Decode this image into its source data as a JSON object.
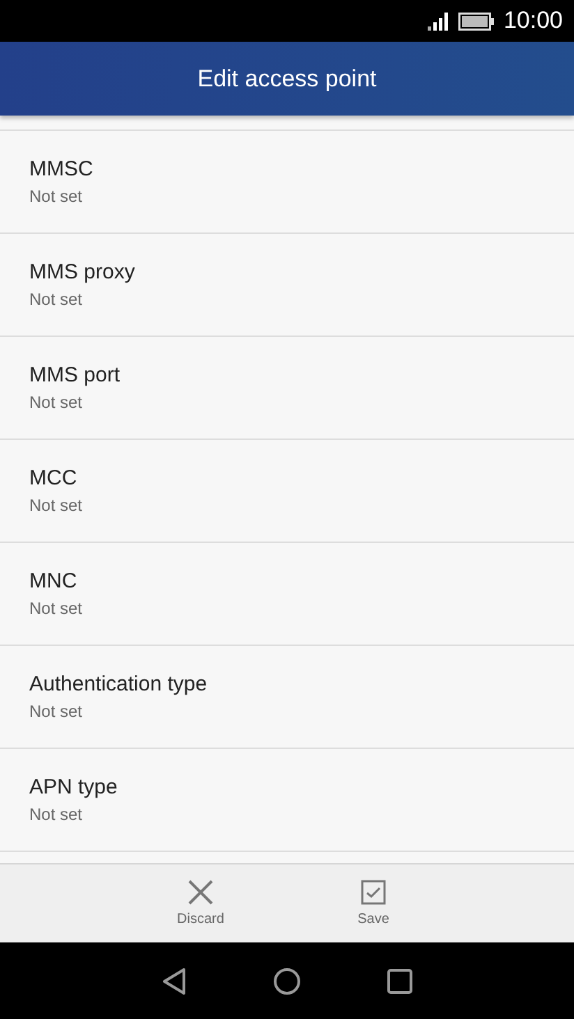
{
  "status_bar": {
    "time": "10:00"
  },
  "header": {
    "title": "Edit access point"
  },
  "settings": [
    {
      "label": "MMSC",
      "value": "Not set"
    },
    {
      "label": "MMS proxy",
      "value": "Not set"
    },
    {
      "label": "MMS port",
      "value": "Not set"
    },
    {
      "label": "MCC",
      "value": "Not set"
    },
    {
      "label": "MNC",
      "value": "Not set"
    },
    {
      "label": "Authentication type",
      "value": "Not set"
    },
    {
      "label": "APN type",
      "value": "Not set"
    }
  ],
  "actions": [
    {
      "kind": "discard",
      "label": "Discard"
    },
    {
      "kind": "save",
      "label": "Save"
    }
  ]
}
